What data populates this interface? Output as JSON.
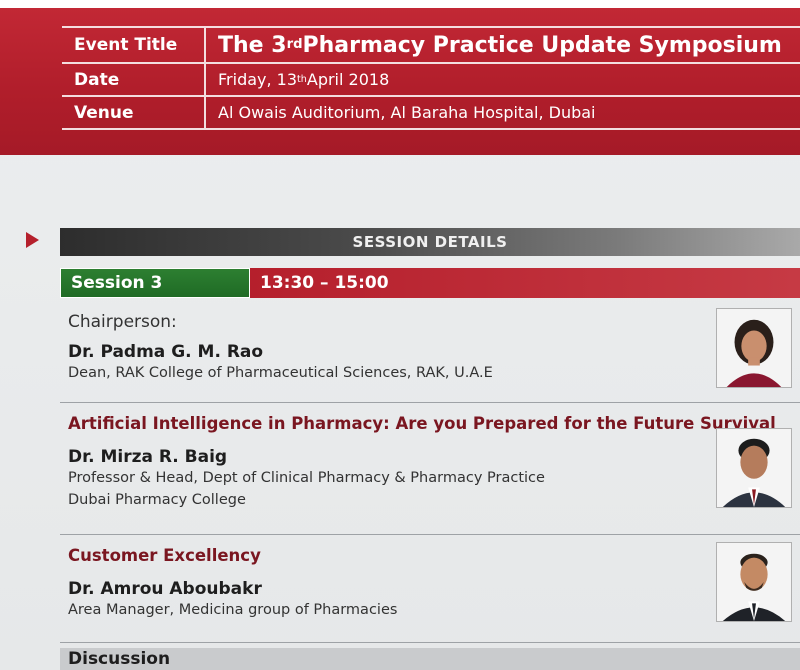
{
  "event": {
    "rows": [
      {
        "label": "Event Title",
        "value": "The 3",
        "sup": "rd",
        "value_rest": " Pharmacy Practice Update Symposium"
      },
      {
        "label": "Date",
        "value": "Friday, 13",
        "sup": "th",
        "value_rest": " April 2018"
      },
      {
        "label": "Venue",
        "value": "Al Owais Auditorium, Al Baraha Hospital, Dubai",
        "sup": "",
        "value_rest": ""
      }
    ]
  },
  "session": {
    "header": "SESSION DETAILS",
    "name": "Session 3",
    "time": "13:30 – 15:00"
  },
  "chair": {
    "label": "Chairperson:",
    "name": "Dr. Padma G. M. Rao",
    "role": "Dean, RAK College of Pharmaceutical Sciences, RAK, U.A.E"
  },
  "talks": [
    {
      "title": "Artificial Intelligence in Pharmacy: Are you Prepared for the Future Survival",
      "name": "Dr. Mirza R. Baig",
      "role_line1": "Professor & Head, Dept of Clinical Pharmacy & Pharmacy Practice",
      "role_line2": "Dubai Pharmacy College"
    },
    {
      "title": "Customer Excellency",
      "name": "Dr. Amrou Aboubakr",
      "role_line1": "Area Manager, Medicina group of Pharmacies",
      "role_line2": ""
    }
  ],
  "discussion": "Discussion",
  "colors": {
    "brand_red": "#b5202c",
    "session_green": "#2d7f31",
    "talk_title": "#7a1620"
  }
}
